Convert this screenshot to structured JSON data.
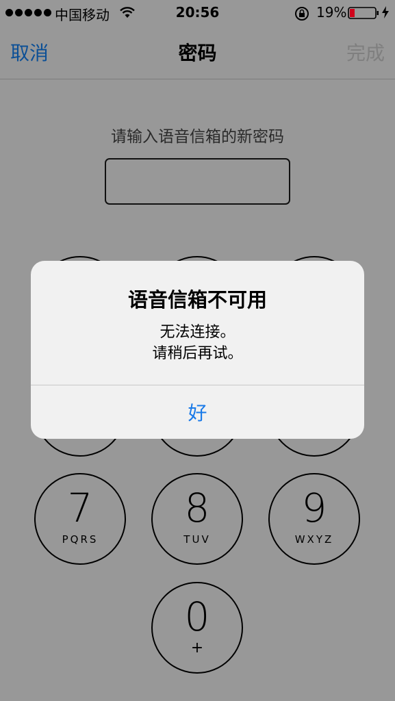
{
  "status_bar": {
    "carrier": "中国移动",
    "time": "20:56",
    "battery_percent": "19%",
    "icons": [
      "signal-dots",
      "wifi-icon",
      "orientation-lock-icon",
      "battery-icon",
      "charging-icon"
    ],
    "battery_level": 0.19,
    "battery_color": "#d0021b"
  },
  "nav": {
    "cancel_label": "取消",
    "title": "密码",
    "done_label": "完成",
    "cancel_color": "#0b4f96",
    "done_color": "#7f7f7f"
  },
  "main": {
    "prompt": "请输入语音信箱的新密码",
    "password_value": ""
  },
  "keypad": {
    "keys": [
      {
        "digit": "7",
        "letters": "PQRS"
      },
      {
        "digit": "8",
        "letters": "TUV"
      },
      {
        "digit": "9",
        "letters": "WXYZ"
      },
      {
        "digit": "0",
        "letters": "+"
      }
    ]
  },
  "alert": {
    "title": "语音信箱不可用",
    "message_line1": "无法连接。",
    "message_line2": "请稍后再试。",
    "ok_label": "好",
    "ok_color": "#1a7ae8"
  }
}
